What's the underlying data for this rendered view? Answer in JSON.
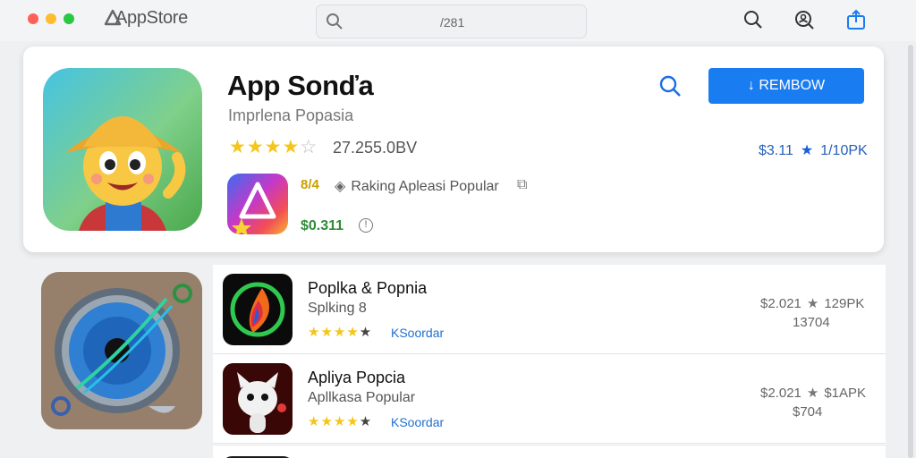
{
  "window": {
    "title": "AppStore"
  },
  "toolbar": {
    "search_value": "/281"
  },
  "featured": {
    "name": "App Sonďa",
    "subtitle": "Imprlena Popasia",
    "rating_stars": 4,
    "rating_count": "27.255.0BV",
    "button_label": "↓ REMBOW",
    "price": "$3.11",
    "downloads": "1/10PK",
    "mini": {
      "badge": "8/4",
      "ranking": "Raking Apleasi Popular",
      "price": "$0.311"
    }
  },
  "list": [
    {
      "name": "Poplka & Popnia",
      "subtitle": "Splking 8",
      "stars": 4,
      "link": "KSoordar",
      "price": "$2.021",
      "downloads": "129PK",
      "count": "13704"
    },
    {
      "name": "Apliya Popcia",
      "subtitle": "Apllkasa Popular",
      "stars": 4,
      "link": "KSoordar",
      "price": "$2.021",
      "downloads": "$1APK",
      "count": "$704"
    }
  ],
  "colors": {
    "accent": "#1a7cf1",
    "star": "#f5c518",
    "price_green": "#2e8b38"
  }
}
